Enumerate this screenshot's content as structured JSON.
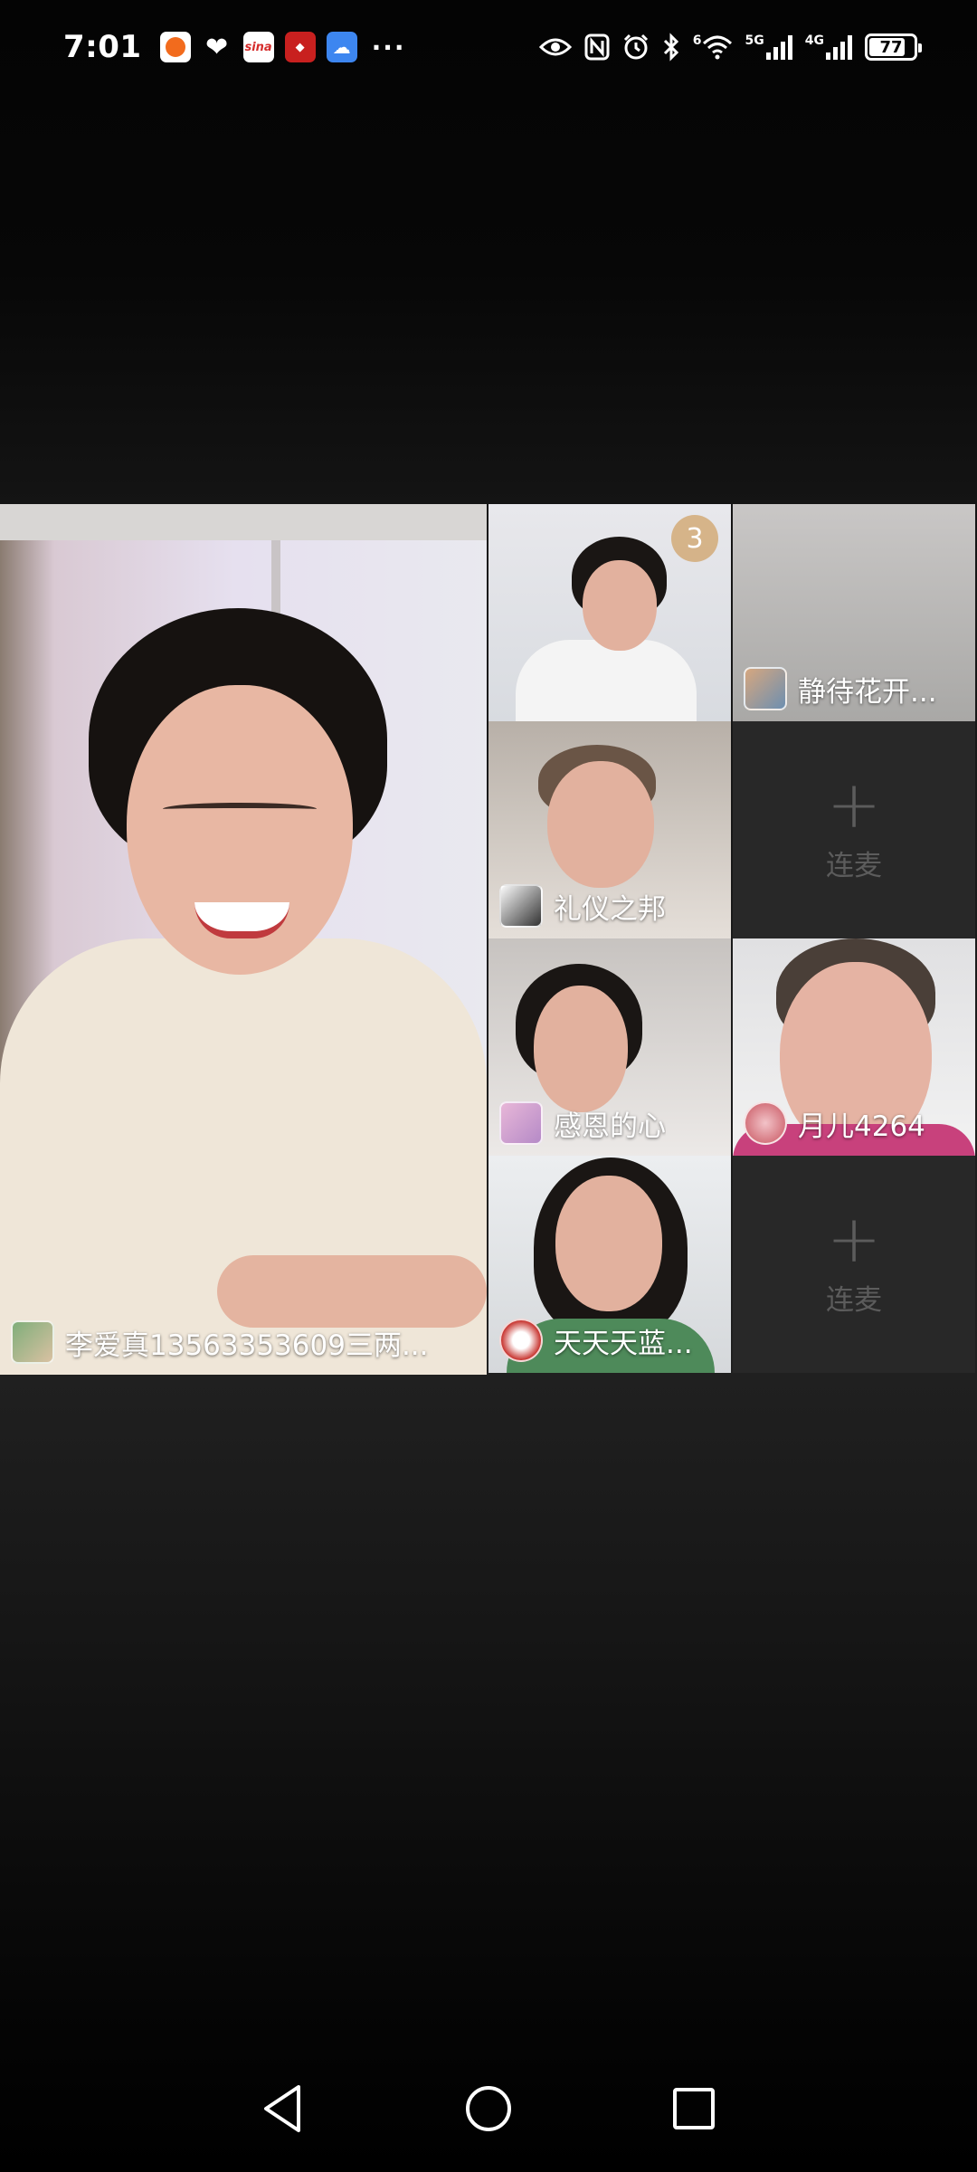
{
  "status_bar": {
    "time": "7:01",
    "app_icons": [
      "news-icon",
      "heart-icon",
      "sina-icon",
      "red-app-icon",
      "cloud-icon"
    ],
    "more": "···",
    "signal_1_label": "5G",
    "signal_2_label": "4G",
    "wifi_label": "6",
    "battery_level": "77"
  },
  "grid": {
    "main": {
      "name": "李爱真13563353609三两..."
    },
    "tiles": [
      {
        "name": "",
        "badge": "3"
      },
      {
        "name": "静待花开..."
      },
      {
        "name": "礼仪之邦"
      },
      {
        "empty": true,
        "label": "连麦"
      },
      {
        "name": "感恩的心"
      },
      {
        "name": "月儿4264"
      },
      {
        "name": "天天天蓝..."
      },
      {
        "empty": true,
        "label": "连麦"
      }
    ]
  },
  "colors": {
    "empty_tile_bg": "#282828",
    "empty_tile_text": "#5c5c5c",
    "badge_bg": "#d2aa78"
  },
  "nav": {
    "back_icon": "back-triangle-icon",
    "home_icon": "home-circle-icon",
    "recents_icon": "recents-square-icon"
  }
}
